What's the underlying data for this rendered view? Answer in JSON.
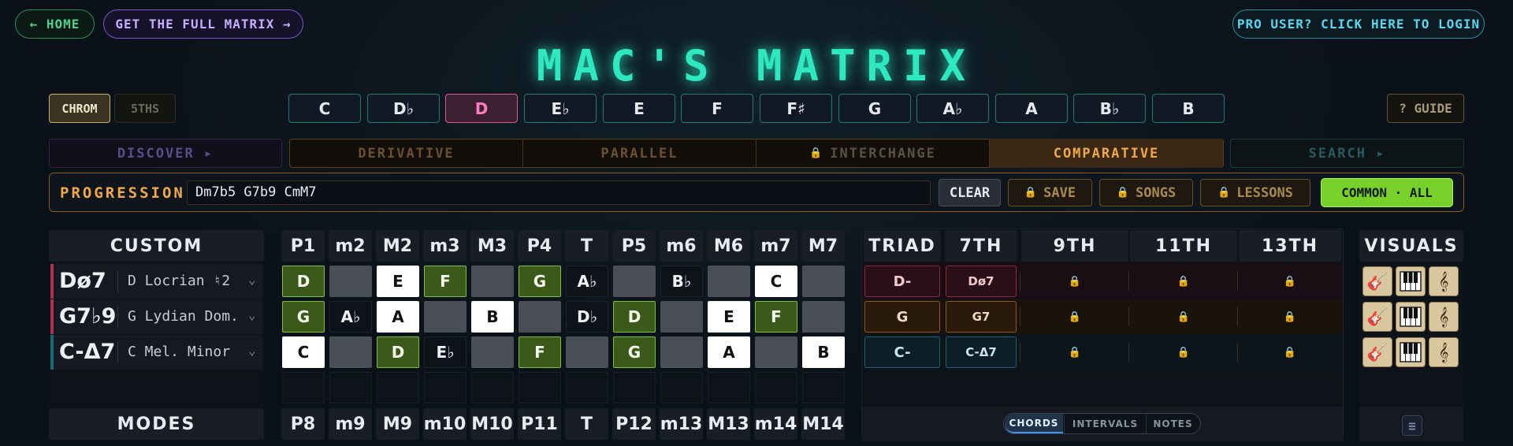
{
  "nav": {
    "home": "← HOME",
    "full_matrix": "GET THE FULL MATRIX →",
    "login": "PRO USER? CLICK HERE TO LOGIN"
  },
  "title": "MAC'S MATRIX",
  "mode_toggle": {
    "chrom": "CHROM",
    "fifths": "5THS"
  },
  "guide": "? GUIDE",
  "keys": [
    "C",
    "D♭",
    "D",
    "E♭",
    "E",
    "F",
    "F♯",
    "G",
    "A♭",
    "A",
    "B♭",
    "B"
  ],
  "active_key": "D",
  "tabs": {
    "discover": "DISCOVER ▸",
    "derivative": "DERIVATIVE",
    "parallel": "PARALLEL",
    "interchange": "INTERCHANGE",
    "comparative": "COMPARATIVE",
    "search": "SEARCH ▸"
  },
  "progression": {
    "label": "PROGRESSION",
    "value": "Dm7b5 G7b9 CmM7",
    "clear": "CLEAR",
    "save": "SAVE",
    "songs": "SONGS",
    "lessons": "LESSONS",
    "common": "COMMON · ALL"
  },
  "custom_header": "CUSTOM",
  "modes_footer": "MODES",
  "interval_headers": [
    "P1",
    "m2",
    "M2",
    "m3",
    "M3",
    "P4",
    "T",
    "P5",
    "m6",
    "M6",
    "m7",
    "M7"
  ],
  "interval_footers": [
    "P8",
    "m9",
    "M9",
    "m10",
    "M10",
    "P11",
    "T",
    "P12",
    "m13",
    "M13",
    "m14",
    "M14"
  ],
  "ext_headers": [
    "TRIAD",
    "7TH",
    "9TH",
    "11TH",
    "13TH"
  ],
  "visuals_header": "VISUALS",
  "chords": [
    {
      "symbol": "Dø7",
      "scale": "D Locrian ♮2",
      "accent": "#b03050",
      "cells": [
        {
          "t": "D",
          "s": "green"
        },
        {
          "t": "",
          "s": "gray"
        },
        {
          "t": "E",
          "s": "white"
        },
        {
          "t": "F",
          "s": "green"
        },
        {
          "t": "",
          "s": "gray"
        },
        {
          "t": "G",
          "s": "green"
        },
        {
          "t": "A♭",
          "s": "dark"
        },
        {
          "t": "",
          "s": "gray"
        },
        {
          "t": "B♭",
          "s": "dark"
        },
        {
          "t": "",
          "s": "gray"
        },
        {
          "t": "C",
          "s": "white"
        },
        {
          "t": "",
          "s": "gray"
        }
      ],
      "triad": "D-",
      "seventh": "Dø7",
      "triad_style": {
        "bg": "#2a0f18",
        "border": "#8a2a40",
        "color": "#f0c8d0"
      },
      "seventh_style": {
        "bg": "#2a0f18",
        "border": "#8a2a40",
        "color": "#f0c8d0"
      },
      "row_bg": "#1a0e14"
    },
    {
      "symbol": "G7♭9",
      "scale": "G Lydian Dom.",
      "accent": "#b03050",
      "cells": [
        {
          "t": "G",
          "s": "green"
        },
        {
          "t": "A♭",
          "s": "dark"
        },
        {
          "t": "A",
          "s": "white"
        },
        {
          "t": "",
          "s": "gray"
        },
        {
          "t": "B",
          "s": "white"
        },
        {
          "t": "",
          "s": "gray"
        },
        {
          "t": "D♭",
          "s": "dark"
        },
        {
          "t": "D",
          "s": "green"
        },
        {
          "t": "",
          "s": "gray"
        },
        {
          "t": "E",
          "s": "white"
        },
        {
          "t": "F",
          "s": "green"
        },
        {
          "t": "",
          "s": "gray"
        }
      ],
      "triad": "G",
      "seventh": "G7",
      "triad_style": {
        "bg": "#2a1a0c",
        "border": "#8a5a22",
        "color": "#f2dcc0"
      },
      "seventh_style": {
        "bg": "#2a1a0c",
        "border": "#8a5a22",
        "color": "#f2dcc0"
      },
      "row_bg": "#1a130c"
    },
    {
      "symbol": "C-Δ7",
      "scale": "C Mel. Minor",
      "accent": "#1a6a78",
      "cells": [
        {
          "t": "C",
          "s": "white"
        },
        {
          "t": "",
          "s": "gray"
        },
        {
          "t": "D",
          "s": "green"
        },
        {
          "t": "E♭",
          "s": "dark"
        },
        {
          "t": "",
          "s": "gray"
        },
        {
          "t": "F",
          "s": "green"
        },
        {
          "t": "",
          "s": "gray"
        },
        {
          "t": "G",
          "s": "green"
        },
        {
          "t": "",
          "s": "gray"
        },
        {
          "t": "A",
          "s": "white"
        },
        {
          "t": "",
          "s": "gray"
        },
        {
          "t": "B",
          "s": "white"
        }
      ],
      "triad": "C-",
      "seventh": "C-Δ7",
      "triad_style": {
        "bg": "#0c1e26",
        "border": "#1e6070",
        "color": "#c8e6ee"
      },
      "seventh_style": {
        "bg": "#0c1e26",
        "border": "#1e6070",
        "color": "#c8e6ee"
      },
      "row_bg": "#0c151c"
    }
  ],
  "view_toggle": {
    "chords": "CHORDS",
    "intervals": "INTERVALS",
    "notes": "NOTES"
  },
  "icons": {
    "lock": "🔒",
    "guitar": "🎸",
    "piano": "piano-icon",
    "clef": "𝄞",
    "menu": "≡",
    "chevron": "⌄"
  }
}
